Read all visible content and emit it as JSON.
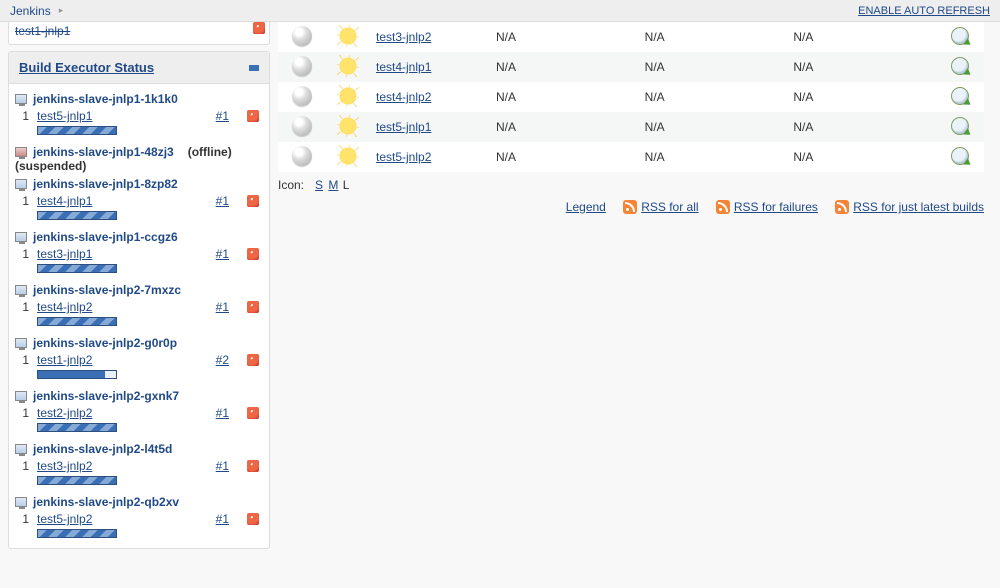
{
  "crumb": {
    "root": "Jenkins",
    "auto_refresh": "ENABLE AUTO REFRESH"
  },
  "partial": {
    "job": "test1-jnlp1"
  },
  "buildExecutor": {
    "title": "Build Executor Status",
    "nodes": [
      {
        "name": "jenkins-slave-jnlp1-1k1k0",
        "offline": false,
        "suspended": false,
        "executors": [
          {
            "num": "1",
            "job": "test5-jnlp1",
            "build": "#1",
            "alt": false
          }
        ]
      },
      {
        "name": "jenkins-slave-jnlp1-48zj3",
        "offline": true,
        "suspended": true,
        "executors": []
      },
      {
        "name": "jenkins-slave-jnlp1-8zp82",
        "offline": false,
        "suspended": false,
        "executors": [
          {
            "num": "1",
            "job": "test4-jnlp1",
            "build": "#1",
            "alt": false
          }
        ]
      },
      {
        "name": "jenkins-slave-jnlp1-ccgz6",
        "offline": false,
        "suspended": false,
        "executors": [
          {
            "num": "1",
            "job": "test3-jnlp1",
            "build": "#1",
            "alt": false
          }
        ]
      },
      {
        "name": "jenkins-slave-jnlp2-7mxzc",
        "offline": false,
        "suspended": false,
        "executors": [
          {
            "num": "1",
            "job": "test4-jnlp2",
            "build": "#1",
            "alt": false
          }
        ]
      },
      {
        "name": "jenkins-slave-jnlp2-g0r0p",
        "offline": false,
        "suspended": false,
        "executors": [
          {
            "num": "1",
            "job": "test1-jnlp2",
            "build": "#2",
            "alt": true
          }
        ]
      },
      {
        "name": "jenkins-slave-jnlp2-gxnk7",
        "offline": false,
        "suspended": false,
        "executors": [
          {
            "num": "1",
            "job": "test2-jnlp2",
            "build": "#1",
            "alt": false
          }
        ]
      },
      {
        "name": "jenkins-slave-jnlp2-l4t5d",
        "offline": false,
        "suspended": false,
        "executors": [
          {
            "num": "1",
            "job": "test3-jnlp2",
            "build": "#1",
            "alt": false
          }
        ]
      },
      {
        "name": "jenkins-slave-jnlp2-qb2xv",
        "offline": false,
        "suspended": false,
        "executors": [
          {
            "num": "1",
            "job": "test5-jnlp2",
            "build": "#1",
            "alt": false
          }
        ]
      }
    ],
    "offline_label": "(offline)",
    "suspended_label": "(suspended)"
  },
  "jobs": [
    {
      "name": "test3-jnlp2",
      "lastSuccess": "N/A",
      "lastFailure": "N/A",
      "lastDuration": "N/A"
    },
    {
      "name": "test4-jnlp1",
      "lastSuccess": "N/A",
      "lastFailure": "N/A",
      "lastDuration": "N/A"
    },
    {
      "name": "test4-jnlp2",
      "lastSuccess": "N/A",
      "lastFailure": "N/A",
      "lastDuration": "N/A"
    },
    {
      "name": "test5-jnlp1",
      "lastSuccess": "N/A",
      "lastFailure": "N/A",
      "lastDuration": "N/A"
    },
    {
      "name": "test5-jnlp2",
      "lastSuccess": "N/A",
      "lastFailure": "N/A",
      "lastDuration": "N/A"
    }
  ],
  "footer": {
    "icon_label": "Icon:",
    "sizes": {
      "s": "S",
      "m": "M",
      "l": "L"
    },
    "legend": "Legend",
    "rss_all": "RSS for all",
    "rss_fail": "RSS for failures",
    "rss_latest": "RSS for just latest builds"
  }
}
